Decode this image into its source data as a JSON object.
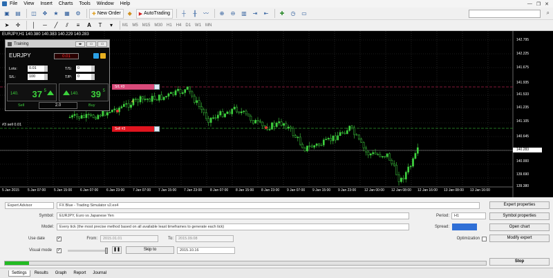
{
  "menu": [
    "File",
    "View",
    "Insert",
    "Charts",
    "Tools",
    "Window",
    "Help"
  ],
  "toolbar": {
    "new_order": "New Order",
    "autotrading": "AutoTrading"
  },
  "timeframes": [
    "M1",
    "M5",
    "M15",
    "M30",
    "H1",
    "H4",
    "D1",
    "W1",
    "MN"
  ],
  "chart": {
    "title": "EURJPY,H1  140.380 140.383 140.229 140.283",
    "trade_label": "#3 sell 0.01",
    "price_labels": [
      "142.795",
      "142.225",
      "141.675",
      "141.935",
      "141.533",
      "141.235",
      "141.105",
      "140.645",
      "140.283",
      "140.000",
      "139.690",
      "139.380"
    ],
    "current_price": "140.283",
    "time_labels": [
      "5 Jan 2015",
      "5 Jan 07:00",
      "5 Jan 15:00",
      "6 Jan 07:00",
      "6 Jan 23:00",
      "7 Jan 07:00",
      "7 Jan 15:00",
      "7 Jan 23:00",
      "8 Jan 07:00",
      "8 Jan 15:00",
      "8 Jan 23:00",
      "9 Jan 07:00",
      "9 Jan 15:00",
      "9 Jan 23:00",
      "12 Jan 00:00",
      "12 Jan 08:00",
      "12 Jan 16:00",
      "13 Jan 08:00",
      "13 Jan 16:00"
    ],
    "sl_tag": "S/L #3",
    "sell_tag": "Sell #3",
    "sl_marker": "4"
  },
  "training": {
    "title": "Training",
    "symbol": "EURJPY",
    "spread": "0.01",
    "lots_label": "Lots:",
    "lots_value": "0.01",
    "sl_label": "S/L:",
    "sl_value": "100",
    "ts_label": "T/S:",
    "ts_value": "0",
    "tp_label": "T/P:",
    "tp_value": "0",
    "sell_small": "140.",
    "sell_big": "37",
    "sell_sup": "5",
    "buy_small": "140.",
    "buy_big": "39",
    "buy_sup": "5",
    "sell_label": "Sell",
    "buy_label": "Buy",
    "multiplier": "2.0"
  },
  "tester": {
    "mode": "Expert Advisor",
    "expert": "FX Blue - Trading Simulator v2.ex4",
    "symbol_label": "Symbol:",
    "symbol_value": "EURJPY, Euro vs Japanese Yen",
    "model_label": "Model:",
    "model_value": "Every tick (the most precise method based on all available least timeframes to generate each tick)",
    "use_date_label": "Use date",
    "from_label": "From:",
    "from_value": "2015.01.01",
    "to_label": "To:",
    "to_value": "2015.09.08",
    "visual_mode_label": "Visual mode",
    "skip_to": "Skip to",
    "skip_date": "2015.10.16",
    "period_label": "Period:",
    "period_value": "H1",
    "spread_label": "Spread:",
    "optimization_label": "Optimization",
    "expert_properties": "Expert properties",
    "symbol_properties": "Symbol properties",
    "open_chart": "Open chart",
    "modify_expert": "Modify expert",
    "stop": "Stop",
    "progress": 0.05
  },
  "tabs": [
    "Settings",
    "Results",
    "Graph",
    "Report",
    "Journal"
  ]
}
